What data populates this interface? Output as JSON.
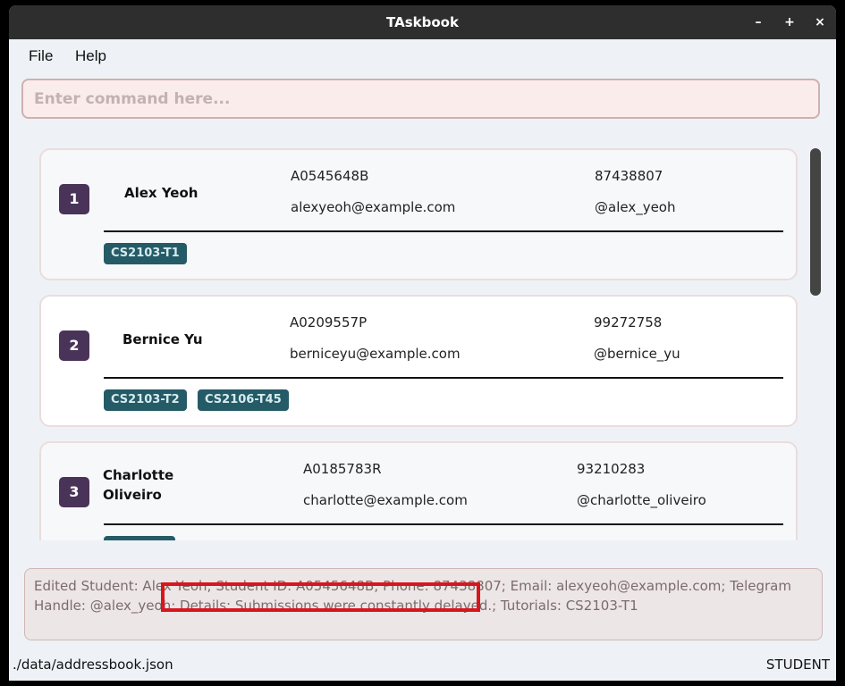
{
  "window": {
    "title": "TAskbook",
    "minimize_label": "–",
    "maximize_label": "+",
    "close_label": "×"
  },
  "menu": [
    {
      "label": "File"
    },
    {
      "label": "Help"
    }
  ],
  "command": {
    "placeholder": "Enter command here...",
    "value": ""
  },
  "students": [
    {
      "index": "1",
      "name": "Alex Yeoh",
      "student_id": "A0545648B",
      "phone": "87438807",
      "email": "alexyeoh@example.com",
      "telegram": "@alex_yeoh",
      "tags": [
        "CS2103-T1"
      ]
    },
    {
      "index": "2",
      "name": "Bernice Yu",
      "student_id": "A0209557P",
      "phone": "99272758",
      "email": "berniceyu@example.com",
      "telegram": "@bernice_yu",
      "tags": [
        "CS2103-T2",
        "CS2106-T45"
      ]
    },
    {
      "index": "3",
      "name_line1": "Charlotte",
      "name_line2": "Oliveiro",
      "student_id": "A0185783R",
      "phone": "93210283",
      "email": "charlotte@example.com",
      "telegram": "@charlotte_oliveiro",
      "tags": [
        ""
      ]
    }
  ],
  "result": {
    "text": "Edited Student: Alex Yeoh; Student ID: A0545648B; Phone: 87438807; Email: alexyeoh@example.com; Telegram Handle: @alex_yeoh; Details: Submissions were constantly delayed.; Tutorials: CS2103-T1"
  },
  "status_bar": {
    "path": "./data/addressbook.json",
    "mode": "STUDENT"
  },
  "colors": {
    "index_badge": "#4a3358",
    "tag": "#245b66",
    "highlight_box": "#d9151e",
    "title_bar": "#2e2e2e"
  }
}
